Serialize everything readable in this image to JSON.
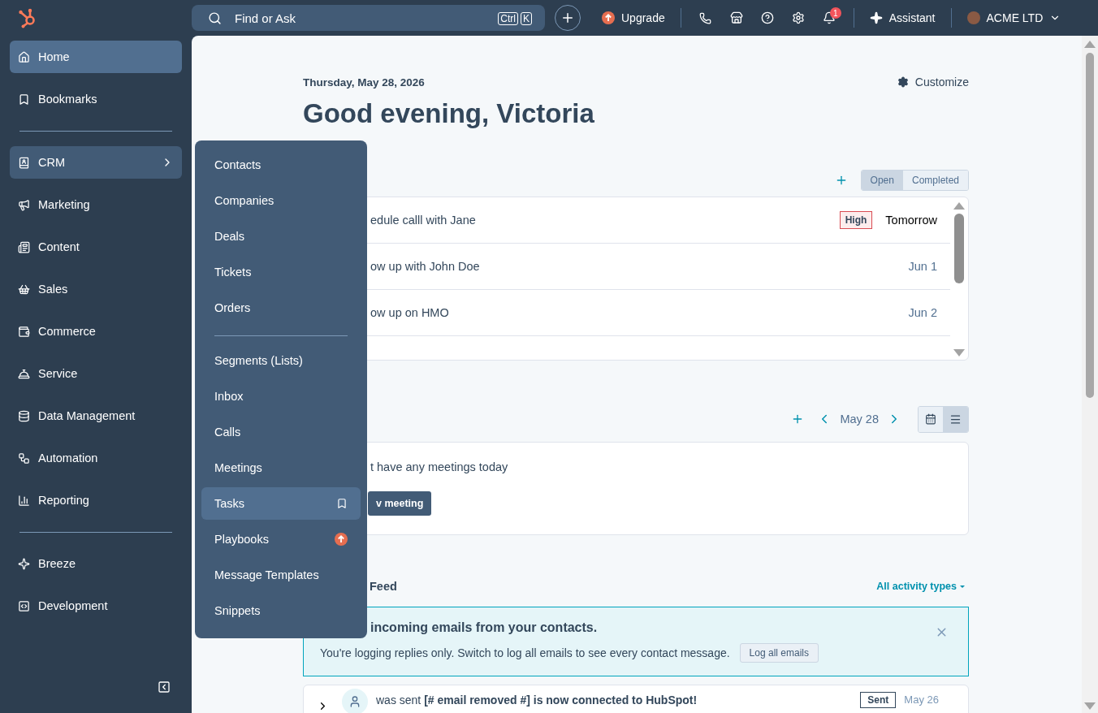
{
  "topbar": {
    "search": {
      "placeholder": "Find or Ask",
      "keys": [
        "Ctrl",
        "K"
      ]
    },
    "upgrade": "Upgrade",
    "notifications": "1",
    "assistant": "Assistant",
    "account": "ACME LTD"
  },
  "sidebar": {
    "sections": [
      {
        "items": [
          {
            "label": "Home",
            "selected": true,
            "expanded": false
          },
          {
            "label": "Bookmarks",
            "selected": false,
            "expanded": false
          }
        ]
      },
      {
        "items": [
          {
            "label": "CRM",
            "selected": false,
            "expanded": true
          },
          {
            "label": "Marketing",
            "selected": false,
            "expanded": false
          },
          {
            "label": "Content",
            "selected": false,
            "expanded": false
          },
          {
            "label": "Sales",
            "selected": false,
            "expanded": false
          },
          {
            "label": "Commerce",
            "selected": false,
            "expanded": false
          },
          {
            "label": "Service",
            "selected": false,
            "expanded": false
          },
          {
            "label": "Data Management",
            "selected": false,
            "expanded": false
          },
          {
            "label": "Automation",
            "selected": false,
            "expanded": false
          },
          {
            "label": "Reporting",
            "selected": false,
            "expanded": false
          }
        ]
      },
      {
        "items": [
          {
            "label": "Breeze",
            "selected": false,
            "expanded": false
          },
          {
            "label": "Development",
            "selected": false,
            "expanded": false
          }
        ]
      }
    ]
  },
  "crm_menu": {
    "sections": [
      {
        "items": [
          {
            "label": "Contacts",
            "selected": false,
            "upgrade": false
          },
          {
            "label": "Companies",
            "selected": false,
            "upgrade": false
          },
          {
            "label": "Deals",
            "selected": false,
            "upgrade": false
          },
          {
            "label": "Tickets",
            "selected": false,
            "upgrade": false
          },
          {
            "label": "Orders",
            "selected": false,
            "upgrade": false
          }
        ]
      },
      {
        "items": [
          {
            "label": "Segments (Lists)",
            "selected": false,
            "upgrade": false
          },
          {
            "label": "Inbox",
            "selected": false,
            "upgrade": false
          },
          {
            "label": "Calls",
            "selected": false,
            "upgrade": false
          },
          {
            "label": "Meetings",
            "selected": false,
            "upgrade": false
          },
          {
            "label": "Tasks",
            "selected": true,
            "upgrade": false
          },
          {
            "label": "Playbooks",
            "selected": false,
            "upgrade": true
          },
          {
            "label": "Message Templates",
            "selected": false,
            "upgrade": false
          },
          {
            "label": "Snippets",
            "selected": false,
            "upgrade": false
          }
        ]
      }
    ]
  },
  "main": {
    "date": "Thursday, May 28, 2026",
    "greeting": "Good evening, Victoria",
    "customize": "Customize",
    "tasks": {
      "tabs": [
        {
          "label": "Open",
          "selected": true
        },
        {
          "label": "Completed",
          "selected": false
        }
      ],
      "rows": [
        {
          "title": "edule calll with Jane",
          "priority": "High",
          "due": "Tomorrow",
          "due_soon": true
        },
        {
          "title": "ow up with John Doe",
          "due": "Jun 1",
          "due_soon": false
        },
        {
          "title": "ow up on HMO",
          "due": "Jun 2",
          "due_soon": false
        }
      ]
    },
    "meetings": {
      "date": "May 28",
      "views": [
        {
          "selected": false
        },
        {
          "selected": true
        }
      ],
      "empty_text": "t have any meetings today",
      "button": "v meeting"
    },
    "feed": {
      "title": "Feed",
      "filter": "All activity types",
      "banner": {
        "title": "incoming emails from your contacts.",
        "text": "You're logging replies only. Switch to log all emails to see every contact message.",
        "button": "Log all emails"
      },
      "items": [
        {
          "text": "was sent **[# email removed #] is now connected to HubSpot!**",
          "status": "Sent",
          "date": "May 26"
        }
      ]
    }
  }
}
